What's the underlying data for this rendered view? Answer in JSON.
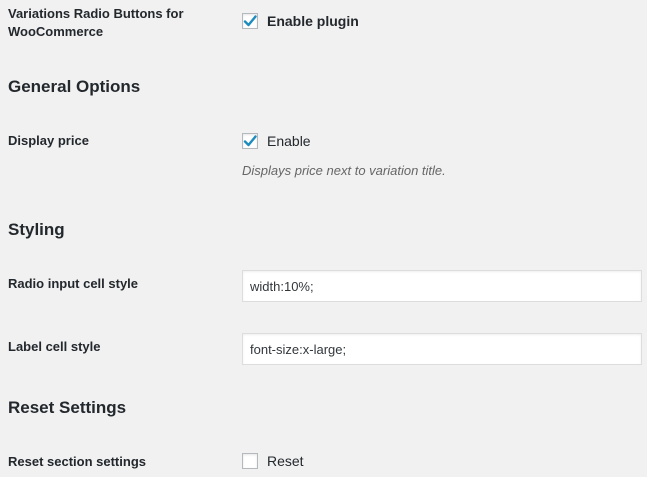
{
  "plugin": {
    "label_line1": "Variations Radio Buttons for",
    "label_line2": "WooCommerce",
    "enable_label": "Enable plugin",
    "enable_checked": true
  },
  "general": {
    "title": "General Options",
    "display_price_label": "Display price",
    "display_price_checkbox_label": "Enable",
    "display_price_checked": true,
    "display_price_description": "Displays price next to variation title."
  },
  "styling": {
    "title": "Styling",
    "radio_cell_label": "Radio input cell style",
    "radio_cell_value": "width:10%;",
    "label_cell_label": "Label cell style",
    "label_cell_value": "font-size:x-large;"
  },
  "reset": {
    "title": "Reset Settings",
    "section_label": "Reset section settings",
    "checkbox_label": "Reset",
    "checked": false
  },
  "colors": {
    "background": "#f1f1f1",
    "check_mark": "#1e8cbe",
    "text": "#23282d",
    "description": "#666666"
  }
}
